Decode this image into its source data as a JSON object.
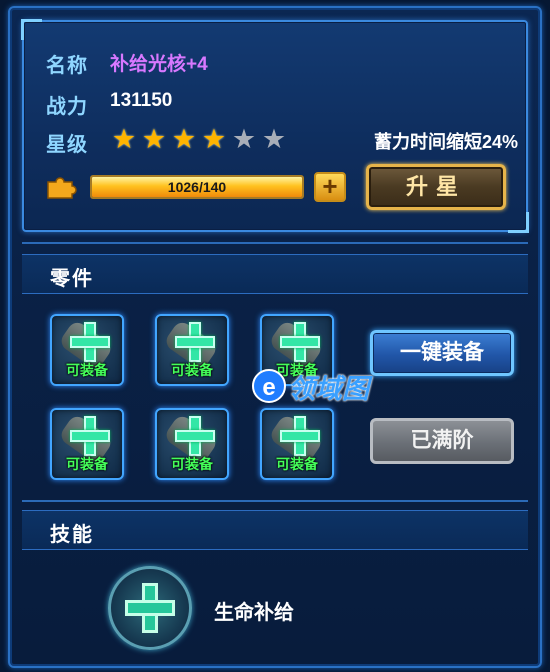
{
  "item": {
    "name_label": "名称",
    "name_value": "补给光核+4",
    "power_label": "战力",
    "power_value": "131150",
    "star_label": "星级",
    "stars_filled": 4,
    "stars_total": 6,
    "bonus_text": "蓄力时间缩短24%",
    "progress_text": "1026/140",
    "progress_fraction": 1.0,
    "plus_label": "+",
    "upgrade_label": "升星"
  },
  "parts": {
    "title": "零件",
    "slots": [
      {
        "label": "可装备"
      },
      {
        "label": "可装备"
      },
      {
        "label": "可装备"
      },
      {
        "label": "可装备"
      },
      {
        "label": "可装备"
      },
      {
        "label": "可装备"
      }
    ],
    "equip_all_label": "一键装备",
    "maxed_label": "已满阶"
  },
  "skills": {
    "title": "技能",
    "skill_name": "生命补给"
  },
  "watermark": {
    "letter": "e",
    "text": "领域图"
  },
  "colors": {
    "name": "#d878ff",
    "label": "#8fd6ff",
    "equippable": "#44ff5a",
    "star_on": "#ffb400",
    "star_off": "#a8aeb8"
  }
}
